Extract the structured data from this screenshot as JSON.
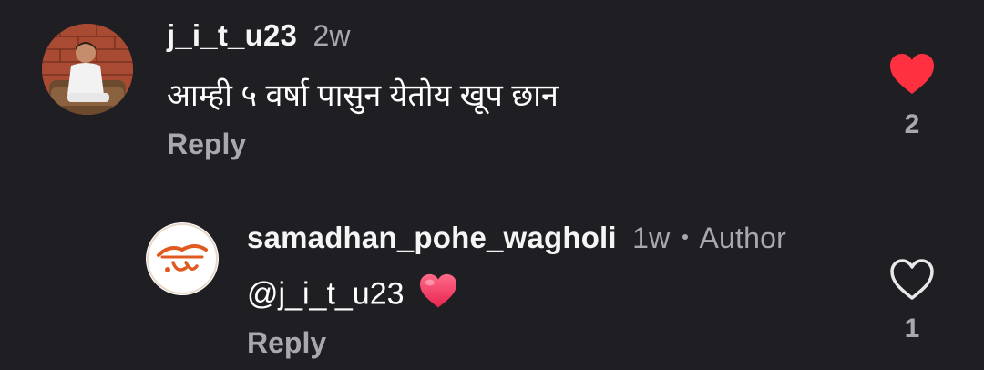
{
  "comments": [
    {
      "username": "j_i_t_u23",
      "age": "2w",
      "text": "आम्ही ५ वर्षा पासुन येतोय खूप छान",
      "reply_label": "Reply",
      "like_count": "2",
      "liked": true,
      "like_color": "#ff3040"
    },
    {
      "username": "samadhan_pohe_wagholi",
      "age": "1w",
      "author_label": "Author",
      "mention": "@j_i_t_u23",
      "emoji": "❤️",
      "reply_label": "Reply",
      "like_count": "1",
      "liked": false,
      "avatar_text": "समाधान पोहे",
      "avatar_color": "#e05a1f"
    }
  ]
}
